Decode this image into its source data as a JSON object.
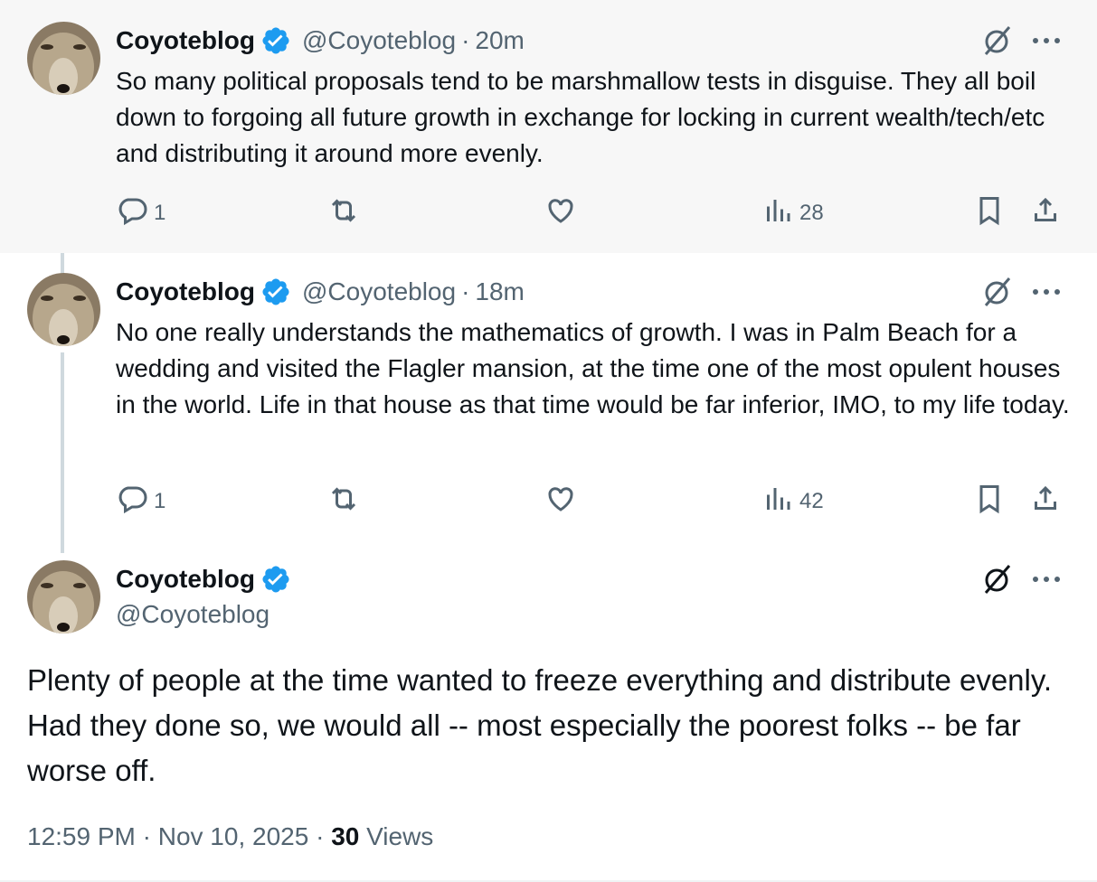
{
  "tweets": [
    {
      "name": "Coyoteblog",
      "handle": "@Coyoteblog",
      "separator": "·",
      "time": "20m",
      "text": "So many political proposals tend to be marshmallow tests in disguise.  They all boil down to forgoing all future growth in exchange for locking in current wealth/tech/etc and distributing it around more evenly.",
      "replies": "1",
      "views": "28"
    },
    {
      "name": "Coyoteblog",
      "handle": "@Coyoteblog",
      "separator": "·",
      "time": "18m",
      "text": "No one really understands the mathematics of growth.  I was in Palm Beach for a wedding and visited the Flagler mansion, at the time one of the most opulent houses in the world.  Life in that house as that time would be far inferior, IMO, to my life today.",
      "replies": "1",
      "views": "42"
    }
  ],
  "main": {
    "name": "Coyoteblog",
    "handle": "@Coyoteblog",
    "text": "Plenty of people at the time wanted to freeze everything and distribute evenly.  Had they done so, we would all -- most especially the poorest folks -- be far worse off.",
    "timestamp": "12:59 PM · Nov 10, 2025 · ",
    "views_count": "30",
    "views_label": " Views"
  },
  "icons": {
    "verified": "verified-badge-icon",
    "grok": "grok-icon",
    "more": "more-dots-icon",
    "reply": "reply-bubble-icon",
    "retweet": "retweet-icon",
    "like": "heart-icon",
    "views": "bar-chart-icon",
    "bookmark": "bookmark-icon",
    "share": "share-upload-icon"
  },
  "colors": {
    "verified": "#1d9bf0",
    "text": "#0f1419",
    "secondary": "#536471",
    "thread_line": "#cfd9de",
    "highlight_bg": "#f7f7f7"
  }
}
